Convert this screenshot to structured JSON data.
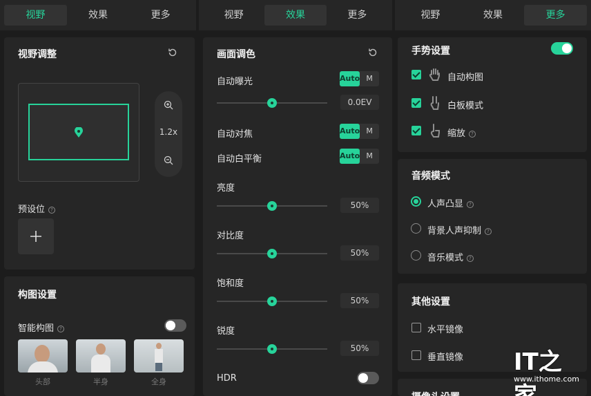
{
  "tabs": [
    "视野",
    "效果",
    "更多"
  ],
  "panel1": {
    "view_card": {
      "title": "视野调整",
      "zoom_value": "1.2x",
      "preset_label": "预设位"
    },
    "composition_card": {
      "title": "构图设置",
      "smart_label": "智能构图",
      "thumbnails": [
        "头部",
        "半身",
        "全身"
      ]
    }
  },
  "panel2": {
    "card_title": "画面调色",
    "auto_exposure": {
      "label": "自动曝光",
      "auto": "Auto",
      "manual": "M",
      "value": "0.0EV"
    },
    "auto_focus": {
      "label": "自动对焦",
      "auto": "Auto",
      "manual": "M"
    },
    "auto_wb": {
      "label": "自动白平衡",
      "auto": "Auto",
      "manual": "M"
    },
    "sliders": [
      {
        "label": "亮度",
        "value": "50%",
        "level": 0.5
      },
      {
        "label": "对比度",
        "value": "50%",
        "level": 0.5
      },
      {
        "label": "饱和度",
        "value": "50%",
        "level": 0.5
      },
      {
        "label": "锐度",
        "value": "50%",
        "level": 0.5
      }
    ],
    "hdr_label": "HDR"
  },
  "panel3": {
    "gesture": {
      "title": "手势设置",
      "items": [
        "自动构图",
        "白板模式",
        "缩放"
      ]
    },
    "audio": {
      "title": "音频模式",
      "options": [
        "人声凸显",
        "背景人声抑制",
        "音乐模式"
      ]
    },
    "other": {
      "title": "其他设置",
      "items": [
        "水平镜像",
        "垂直镜像"
      ]
    },
    "partial_title": "摄像头设置"
  },
  "watermark": {
    "logo": "IT之家",
    "url": "www.ithome.com"
  },
  "colors": {
    "accent": "#27d39a",
    "panel": "#262626",
    "bg": "#1c1c1c"
  }
}
